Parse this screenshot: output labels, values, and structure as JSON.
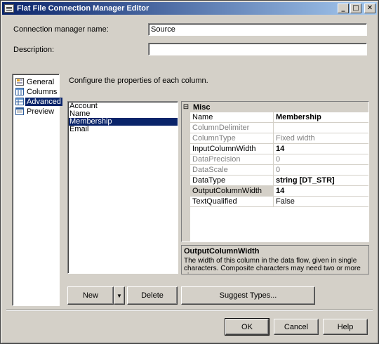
{
  "window": {
    "title": "Flat File Connection Manager Editor",
    "minimize_glyph": "_",
    "maximize_glyph": "□",
    "close_glyph": "✕"
  },
  "form": {
    "name_label": "Connection manager name:",
    "name_value": "Source",
    "description_label": "Description:",
    "description_value": ""
  },
  "nav": {
    "items": [
      {
        "label": "General",
        "icon": "general-icon"
      },
      {
        "label": "Columns",
        "icon": "columns-icon"
      },
      {
        "label": "Advanced",
        "icon": "advanced-icon",
        "selected": true
      },
      {
        "label": "Preview",
        "icon": "preview-icon"
      }
    ]
  },
  "main": {
    "instruction": "Configure the properties of each column.",
    "columns": [
      "Account",
      "Name",
      "Membership",
      "Email"
    ],
    "selected_column": "Membership"
  },
  "grid": {
    "category": "Misc",
    "collapse_glyph": "⊟",
    "rows": [
      {
        "name": "Name",
        "value": "Membership",
        "bold": true
      },
      {
        "name": "ColumnDelimiter",
        "value": "",
        "disabled": true
      },
      {
        "name": "ColumnType",
        "value": "Fixed width",
        "disabled": true
      },
      {
        "name": "InputColumnWidth",
        "value": "14",
        "bold": true
      },
      {
        "name": "DataPrecision",
        "value": "0",
        "disabled": true
      },
      {
        "name": "DataScale",
        "value": "0",
        "disabled": true
      },
      {
        "name": "DataType",
        "value": "string [DT_STR]",
        "bold": true
      },
      {
        "name": "OutputColumnWidth",
        "value": "14",
        "bold": true,
        "highlight": true
      },
      {
        "name": "TextQualified",
        "value": "False"
      }
    ],
    "help_title": "OutputColumnWidth",
    "help_text": "The width of this column in the data flow, given in single characters. Composite characters may need two or more sin..."
  },
  "buttons": {
    "new": "New",
    "new_dropdown_glyph": "▼",
    "delete": "Delete",
    "suggest_types": "Suggest Types...",
    "ok": "OK",
    "cancel": "Cancel",
    "help": "Help"
  },
  "colors": {
    "selection": "#0a246a",
    "dialog_face": "#d4d0c8",
    "disabled_text": "#808080"
  }
}
